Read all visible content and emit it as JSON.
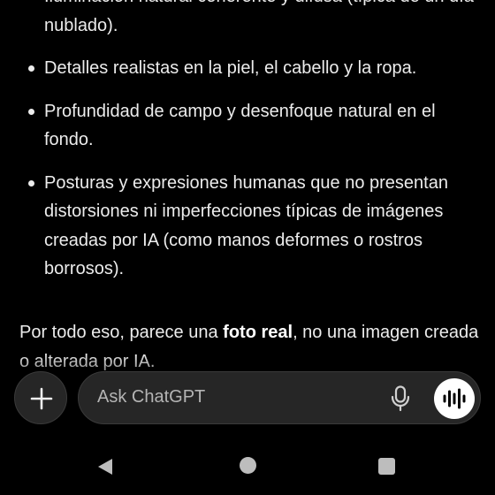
{
  "bullets": [
    "Iluminación natural coherente y difusa (típica de un día nublado).",
    "Detalles realistas en la piel, el cabello y la ropa.",
    "Profundidad de campo y desenfoque natural en el fondo.",
    "Posturas y expresiones humanas que no presentan distorsiones ni imperfecciones típicas de imágenes creadas por IA (como manos deformes o rostros borrosos)."
  ],
  "closing": {
    "before": "Por todo eso, parece una ",
    "bold": "foto real",
    "after": ", no una imagen creada o alterada por IA."
  },
  "composer": {
    "placeholder": "Ask ChatGPT",
    "plus_icon": "plus-icon",
    "mic_icon": "microphone-icon",
    "voice_icon": "voice-mode-icon"
  },
  "navbar": {
    "back_icon": "back-triangle-icon",
    "home_icon": "home-circle-icon",
    "recents_icon": "recents-square-icon"
  }
}
